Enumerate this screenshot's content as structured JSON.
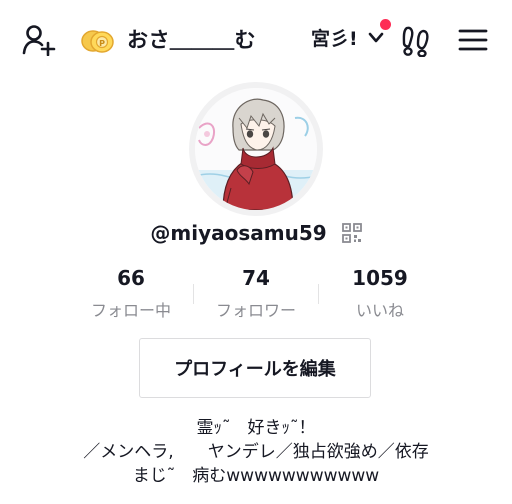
{
  "header": {
    "display_name": "おさ＿＿＿む",
    "account_switch_label": "宮彡!",
    "notification_dot_color": "#fe2c55",
    "icons": [
      "add-friend-icon",
      "coin-icon",
      "chevron-down-icon",
      "footprints-icon",
      "menu-icon"
    ]
  },
  "profile": {
    "username": "@miyaosamu59",
    "qr_icon": "qr-code-icon"
  },
  "stats": [
    {
      "value": "66",
      "label": "フォロー中"
    },
    {
      "value": "74",
      "label": "フォロワー"
    },
    {
      "value": "1059",
      "label": "いいね"
    }
  ],
  "actions": {
    "edit_profile_label": "プロフィールを編集"
  },
  "bio": {
    "lines": [
      "霊ｯ˜　好きｯ˜！",
      "／メンヘラ,　　ヤンデレ／独占欲強め／依存",
      "まじ˜　病むwwwwwwwwwww"
    ]
  }
}
